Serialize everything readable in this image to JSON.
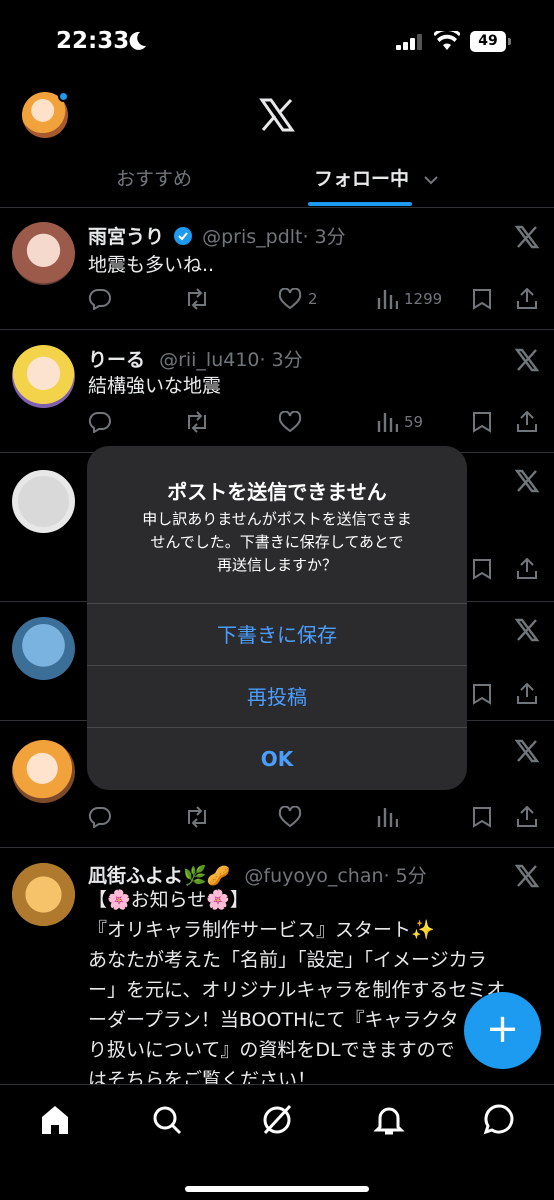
{
  "status": {
    "time": "22:33",
    "battery": "49"
  },
  "tabs": {
    "recommended": "おすすめ",
    "following": "フォロー中"
  },
  "posts": [
    {
      "name": "雨宮うり",
      "handle": "@pris_pdlt",
      "age": "· 3分",
      "text": "地震も多いね..",
      "likes": "2",
      "views": "1299",
      "verified": true
    },
    {
      "name": "りーる",
      "handle": "@rii_lu410",
      "age": "· 3分",
      "text": "結構強いな地震",
      "likes": "",
      "views": "59",
      "verified": false
    },
    {
      "name": "凪街ふよよ🌿🥜",
      "handle": "@fuyoyo_chan",
      "age": "· 5分",
      "lines": [
        "【🌸お知らせ🌸】",
        "『オリキャラ制作サービス』スタート✨",
        "あなたが考えた「名前」「設定」「イメージカラ",
        "ー」を元に、オリジナルキャラを制作するセミオ",
        "ーダープラン！当BOOTHにて『キャラクタ",
        "り扱いについて』の資料をDLできますので",
        "はそちらをご覧ください！"
      ]
    }
  ],
  "alert": {
    "title": "ポストを送信できません",
    "message_lines": [
      "申し訳ありませんがポストを送信できま",
      "せんでした。下書きに保存してあとで",
      "再送信しますか？"
    ],
    "save_draft": "下書きに保存",
    "repost": "再投稿",
    "ok": "OK"
  },
  "fab": {
    "label": "+"
  },
  "icons": [
    "x-logo",
    "grok-icon",
    "reply-icon",
    "repost-icon",
    "like-icon",
    "views-icon",
    "bookmark-icon",
    "share-icon",
    "home-icon",
    "search-icon",
    "grok-tab-icon",
    "notifications-icon",
    "messages-icon"
  ],
  "colors": {
    "accent": "#1d9bf0",
    "alert_button": "#4a9eff",
    "background": "#000000"
  }
}
